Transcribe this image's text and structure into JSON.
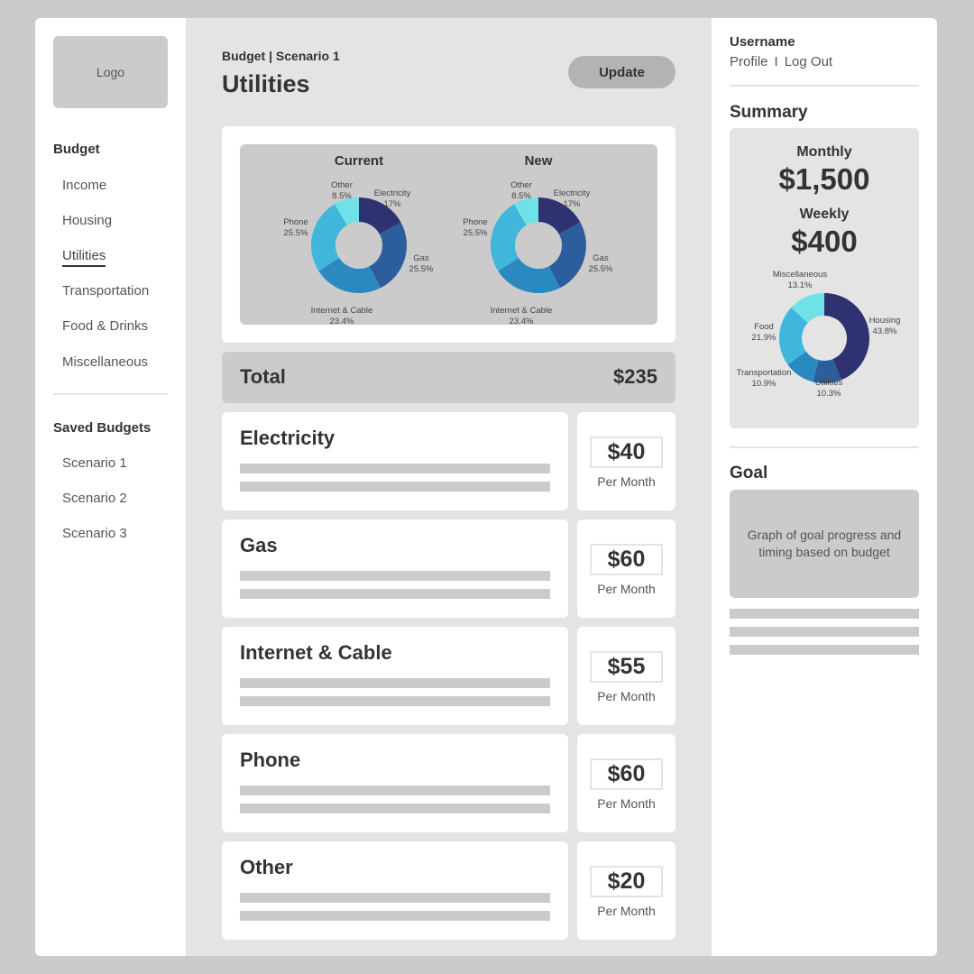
{
  "sidebar": {
    "logo": "Logo",
    "budget_heading": "Budget",
    "budget_items": [
      {
        "label": "Income"
      },
      {
        "label": "Housing"
      },
      {
        "label": "Utilities"
      },
      {
        "label": "Transportation"
      },
      {
        "label": "Food & Drinks"
      },
      {
        "label": "Miscellaneous"
      }
    ],
    "active_item": "Utilities",
    "saved_heading": "Saved Budgets",
    "saved_items": [
      {
        "label": "Scenario 1"
      },
      {
        "label": "Scenario 2"
      },
      {
        "label": "Scenario 3"
      }
    ]
  },
  "main": {
    "breadcrumb": "Budget | Scenario 1",
    "title": "Utilities",
    "update_label": "Update",
    "total_label": "Total",
    "total_value": "$235",
    "rows": [
      {
        "name": "Electricity",
        "amount": "$40",
        "unit": "Per Month"
      },
      {
        "name": "Gas",
        "amount": "$60",
        "unit": "Per Month"
      },
      {
        "name": "Internet & Cable",
        "amount": "$55",
        "unit": "Per Month"
      },
      {
        "name": "Phone",
        "amount": "$60",
        "unit": "Per Month"
      },
      {
        "name": "Other",
        "amount": "$20",
        "unit": "Per Month"
      }
    ]
  },
  "right": {
    "username": "Username",
    "profile_label": "Profile",
    "separator": "I",
    "logout_label": "Log Out",
    "summary_title": "Summary",
    "monthly_label": "Monthly",
    "monthly_value": "$1,500",
    "weekly_label": "Weekly",
    "weekly_value": "$400",
    "goal_title": "Goal",
    "goal_placeholder": "Graph of goal progress and timing based on budget"
  },
  "colors": {
    "navy": "#2e3270",
    "blue": "#2c5d9c",
    "mid_blue": "#2a8ac0",
    "light_blue": "#40b6dc",
    "cyan": "#6ee2e6"
  },
  "chart_data": [
    {
      "type": "pie",
      "title": "Current",
      "categories": [
        "Electricity",
        "Gas",
        "Internet & Cable",
        "Phone",
        "Other"
      ],
      "values": [
        17,
        25.5,
        23.4,
        25.5,
        8.5
      ],
      "labels": [
        "17%",
        "25.5%",
        "23.4%",
        "25.5%",
        "8.5%"
      ]
    },
    {
      "type": "pie",
      "title": "New",
      "categories": [
        "Electricity",
        "Gas",
        "Internet & Cable",
        "Phone",
        "Other"
      ],
      "values": [
        17,
        25.5,
        23.4,
        25.5,
        8.5
      ],
      "labels": [
        "17%",
        "25.5%",
        "23.4%",
        "25.5%",
        "8.5%"
      ]
    },
    {
      "type": "pie",
      "title": "",
      "categories": [
        "Housing",
        "Utilities",
        "Transportation",
        "Food",
        "Miscellaneous"
      ],
      "values": [
        43.8,
        10.3,
        10.9,
        21.9,
        13.1
      ],
      "labels": [
        "43.8%",
        "10.3%",
        "10.9%",
        "21.9%",
        "13.1%"
      ]
    }
  ]
}
